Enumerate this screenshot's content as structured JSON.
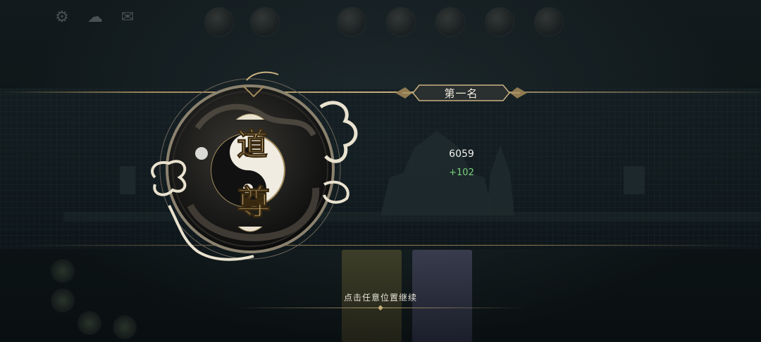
{
  "rank": {
    "label": "第一名"
  },
  "score": {
    "value": "6059",
    "delta": "+102"
  },
  "emblem": {
    "calligraphy": "道尊"
  },
  "continue_hint": "点击任意位置继续",
  "colors": {
    "gold": "#c9b180",
    "delta_green": "#7ad07a",
    "banner": "#141e22"
  },
  "icons": [
    "gear-icon",
    "chat-icon",
    "message-icon"
  ]
}
